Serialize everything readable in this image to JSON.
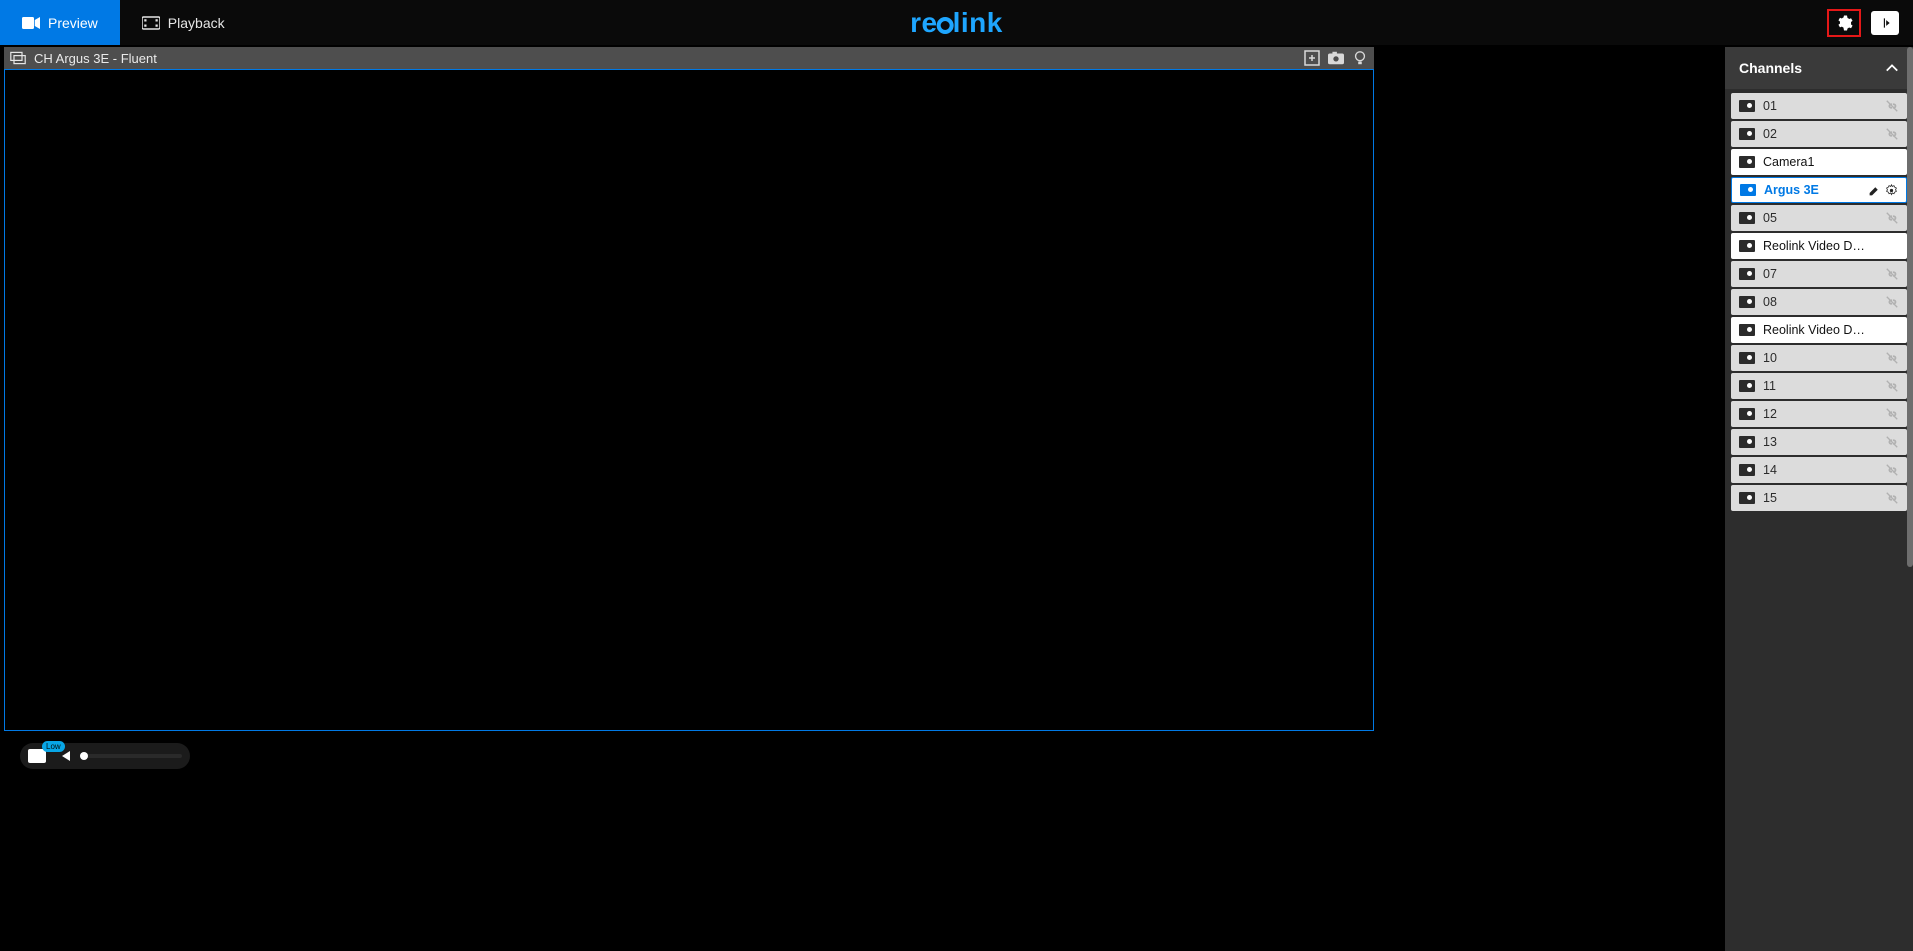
{
  "topbar": {
    "preview": "Preview",
    "playback": "Playback",
    "brand_prefix": "re",
    "brand_suffix": "link"
  },
  "subheader": {
    "title": "CH Argus 3E - Fluent"
  },
  "bottombar": {
    "badge": "Low"
  },
  "side": {
    "header": "Channels",
    "items": [
      {
        "label": "01",
        "state": "off",
        "linkbroken": true
      },
      {
        "label": "02",
        "state": "off",
        "linkbroken": true
      },
      {
        "label": "Camera1",
        "state": "on"
      },
      {
        "label": "Argus 3E",
        "state": "sel"
      },
      {
        "label": "05",
        "state": "off",
        "linkbroken": true
      },
      {
        "label": "Reolink Video D…",
        "state": "on"
      },
      {
        "label": "07",
        "state": "off",
        "linkbroken": true
      },
      {
        "label": "08",
        "state": "off",
        "linkbroken": true
      },
      {
        "label": "Reolink Video D…",
        "state": "on"
      },
      {
        "label": "10",
        "state": "off",
        "linkbroken": true
      },
      {
        "label": "11",
        "state": "off",
        "linkbroken": true
      },
      {
        "label": "12",
        "state": "off",
        "linkbroken": true
      },
      {
        "label": "13",
        "state": "off",
        "linkbroken": true
      },
      {
        "label": "14",
        "state": "off",
        "linkbroken": true
      },
      {
        "label": "15",
        "state": "off",
        "linkbroken": true
      }
    ]
  }
}
